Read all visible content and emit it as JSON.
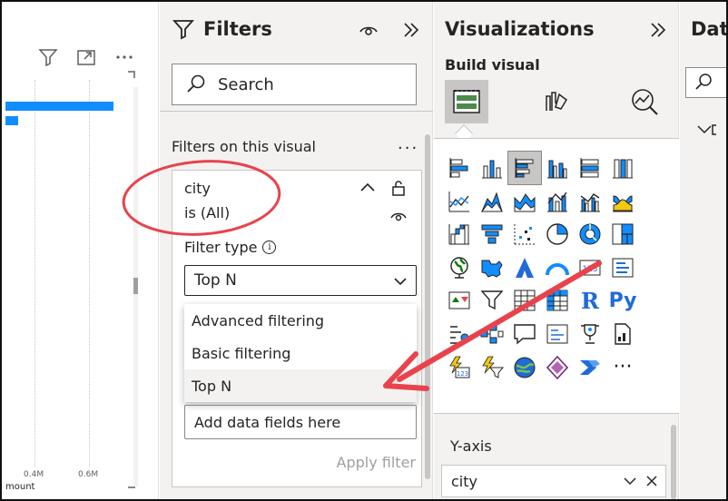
{
  "canvas": {
    "ticks": [
      "0.4M",
      "0.6M"
    ],
    "axis_label": "mount",
    "toolbar": {
      "filter_icon": "filter-icon",
      "focus_icon": "focus-mode-icon",
      "more_icon": "more-options-icon"
    }
  },
  "filters": {
    "title": "Filters",
    "search_placeholder": "Search",
    "section_label": "Filters on this visual",
    "more": "...",
    "card": {
      "field": "city",
      "condition": "is (All)",
      "filter_type_label": "Filter type",
      "selected_type": "Top N",
      "options": [
        {
          "label": "Advanced filtering"
        },
        {
          "label": "Basic filtering"
        },
        {
          "label": "Top N"
        }
      ],
      "data_fields_placeholder": "Add data fields here",
      "apply_label": "Apply filter"
    }
  },
  "visualizations": {
    "title": "Visualizations",
    "build_visual": "Build visual",
    "gallery": {
      "r_label": "R",
      "py_label": "Py",
      "more": "···"
    },
    "y_axis_label": "Y-axis",
    "y_axis_field": "city"
  },
  "data_panel": {
    "title": "Data"
  },
  "colors": {
    "accent": "#118dff",
    "annotation": "#e8434d",
    "panel_bg": "#f3f2f1"
  }
}
